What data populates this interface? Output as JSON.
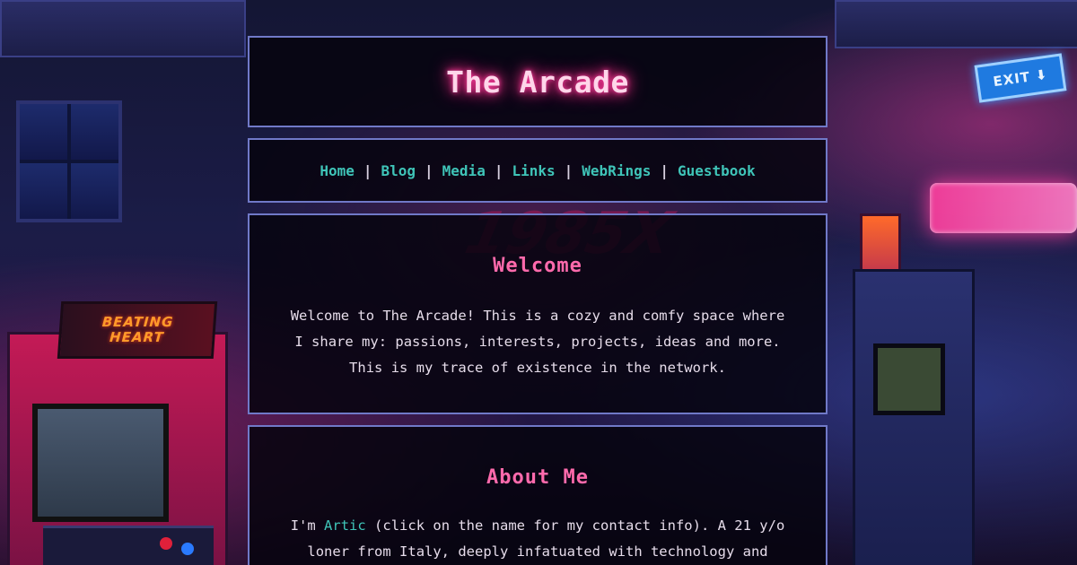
{
  "site": {
    "title": "The Arcade"
  },
  "nav": {
    "items": [
      {
        "label": "Home"
      },
      {
        "label": "Blog"
      },
      {
        "label": "Media"
      },
      {
        "label": "Links"
      },
      {
        "label": "WebRings"
      },
      {
        "label": "Guestbook"
      }
    ],
    "separator": "|"
  },
  "welcome": {
    "heading": "Welcome",
    "lines": [
      "Welcome to The Arcade! This is a cozy and comfy space where",
      "I share my: passions, interests, projects, ideas and more.",
      "This is my trace of existence in the network."
    ]
  },
  "about": {
    "heading": "About Me",
    "line1_prefix": "I'm ",
    "name_link": "Artic",
    "line1_suffix": " (click on the name for my contact info). A 21 y/o",
    "line2": "loner from Italy, deeply infatuated with technology and"
  },
  "background": {
    "cabinet_marquee": "BEATING\nHEART",
    "exit_sign": "EXIT",
    "graffiti": "1985X"
  },
  "colors": {
    "panel_border": "#7079c8",
    "title_glow": "#ff2d8a",
    "heading": "#ff6aac",
    "link": "#3fc4b8"
  }
}
